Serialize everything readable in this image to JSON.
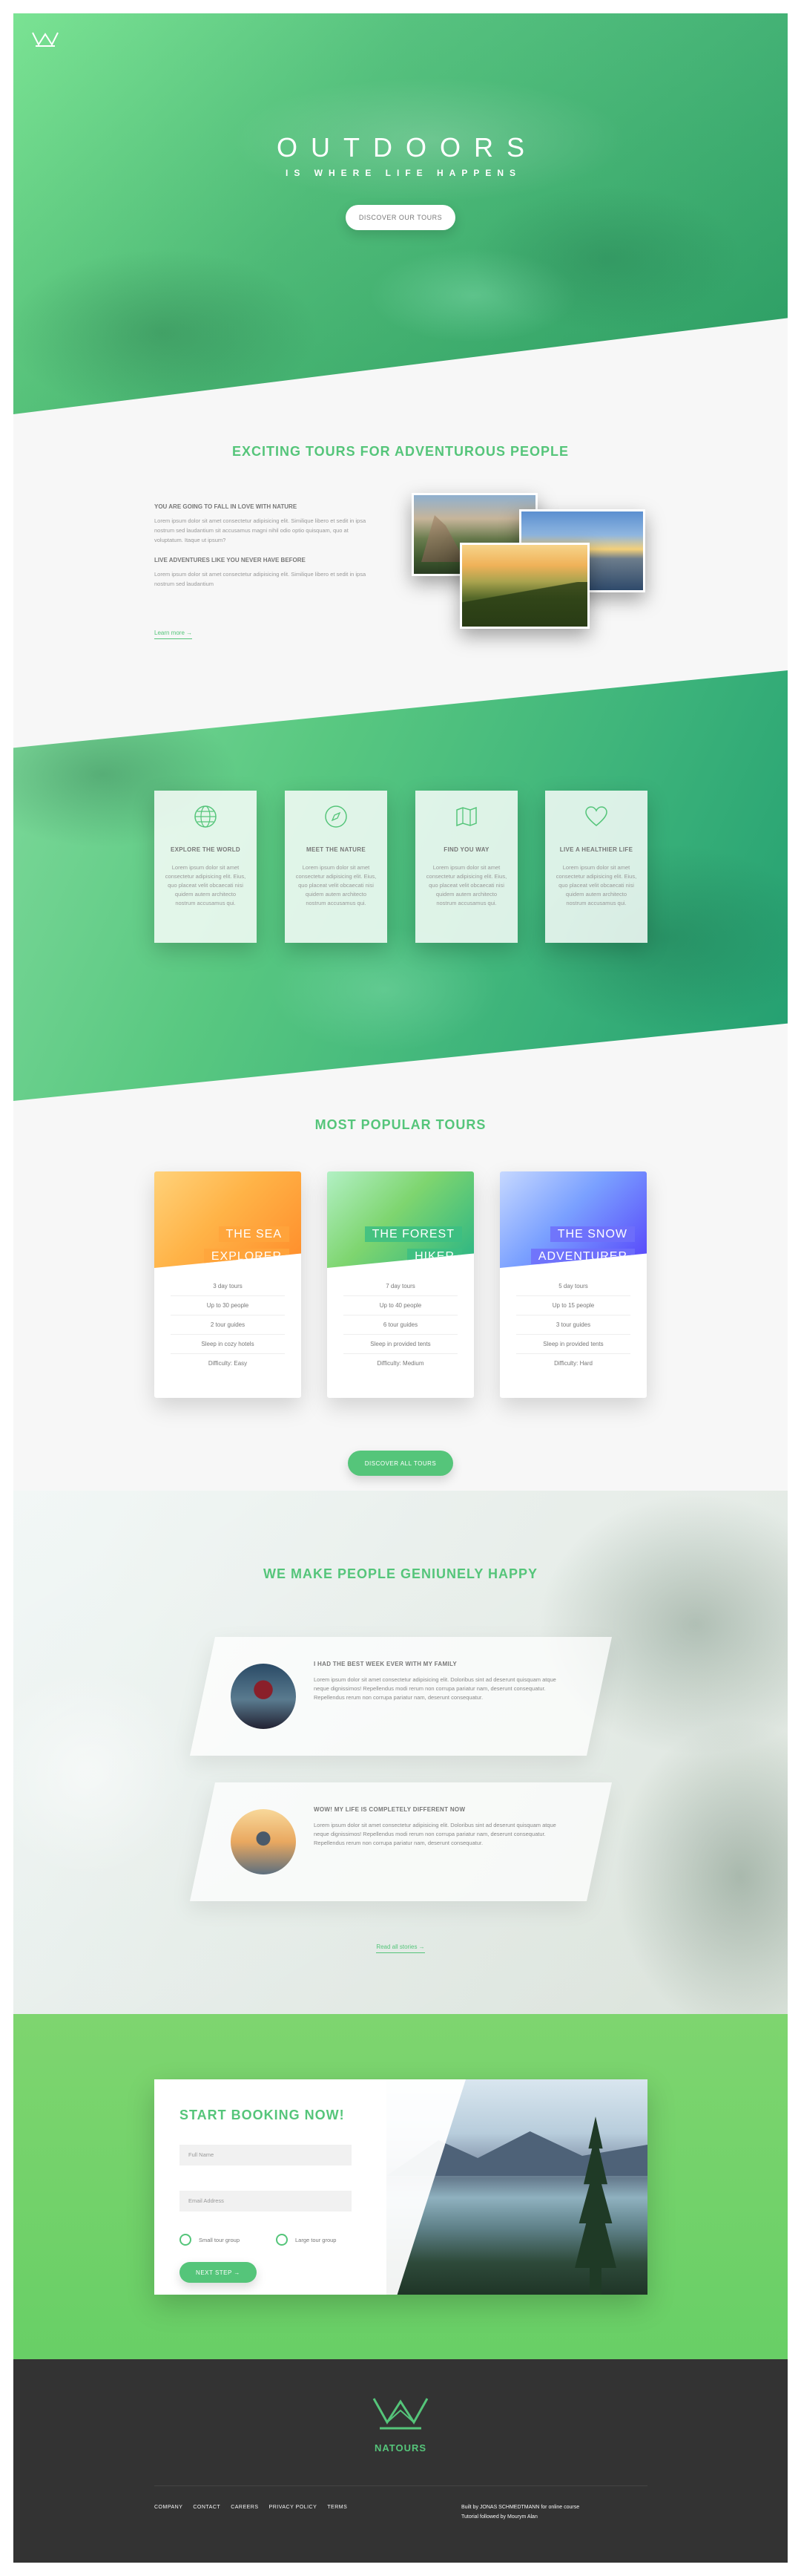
{
  "hero": {
    "title": "OUTDOORS",
    "subtitle": "IS WHERE LIFE HAPPENS",
    "cta": "DISCOVER OUR TOURS"
  },
  "about": {
    "title": "EXCITING TOURS FOR ADVENTUROUS PEOPLE",
    "h1": "YOU ARE GOING TO FALL IN LOVE WITH NATURE",
    "p1": "Lorem ipsum dolor sit amet consectetur adipisicing elit. Similique libero et sedit in ipsa nostrum sed laudantium sit accusamus magni nihil odio optio quisquam, quo at voluptatum. Itaque ut ipsum?",
    "h2": "LIVE ADVENTURES LIKE YOU NEVER HAVE BEFORE",
    "p2": "Lorem ipsum dolor sit amet consectetur adipisicing elit. Similique libero et sedit in ipsa nostrum sed laudantium",
    "link": "Learn more →"
  },
  "features": [
    {
      "icon": "globe-icon",
      "title": "EXPLORE THE WORLD",
      "text": "Lorem ipsum dolor sit amet consectetur adipisicing elit. Eius, quo placeat velit obcaecati nisi quidem autem architecto nostrum accusamus qui."
    },
    {
      "icon": "compass-icon",
      "title": "MEET THE NATURE",
      "text": "Lorem ipsum dolor sit amet consectetur adipisicing elit. Eius, quo placeat velit obcaecati nisi quidem autem architecto nostrum accusamus qui."
    },
    {
      "icon": "map-icon",
      "title": "FIND YOU WAY",
      "text": "Lorem ipsum dolor sit amet consectetur adipisicing elit. Eius, quo placeat velit obcaecati nisi quidem autem architecto nostrum accusamus qui."
    },
    {
      "icon": "heart-icon",
      "title": "LIVE A HEALTHIER LIFE",
      "text": "Lorem ipsum dolor sit amet consectetur adipisicing elit. Eius, quo placeat velit obcaecati nisi quidem autem architecto nostrum accusamus qui."
    }
  ],
  "tours": {
    "title": "MOST POPULAR TOURS",
    "cards": [
      {
        "line1": "THE SEA",
        "line2": "EXPLORER",
        "details": [
          "3 day tours",
          "Up to 30 people",
          "2 tour guides",
          "Sleep in cozy hotels",
          "Difficulty: Easy"
        ]
      },
      {
        "line1": "THE FOREST",
        "line2": "HIKER",
        "details": [
          "7 day tours",
          "Up to 40 people",
          "6 tour guides",
          "Sleep in provided tents",
          "Difficulty: Medium"
        ]
      },
      {
        "line1": "THE SNOW",
        "line2": "ADVENTURER",
        "details": [
          "5 day tours",
          "Up to 15 people",
          "3 tour guides",
          "Sleep in provided tents",
          "Difficulty: Hard"
        ]
      }
    ],
    "cta": "DISCOVER ALL TOURS"
  },
  "stories": {
    "title": "WE MAKE PEOPLE GENIUNELY HAPPY",
    "items": [
      {
        "title": "I HAD THE BEST WEEK EVER WITH MY FAMILY",
        "text": "Lorem ipsum dolor sit amet consectetur adipisicing elit. Doloribus sint ad deserunt quisquam atque neque dignissimos! Repellendus modi rerum non corrupa pariatur nam, deserunt consequatur. Repellendus rerum non corrupa pariatur nam, deserunt consequatur."
      },
      {
        "title": "WOW! MY LIFE IS COMPLETELY DIFFERENT NOW",
        "text": "Lorem ipsum dolor sit amet consectetur adipisicing elit. Doloribus sint ad deserunt quisquam atque neque dignissimos! Repellendus modi rerum non corrupa pariatur nam, deserunt consequatur. Repellendus rerum non corrupa pariatur nam, deserunt consequatur."
      }
    ],
    "link": "Read all stories →"
  },
  "booking": {
    "title": "START BOOKING NOW!",
    "name_placeholder": "Full Name",
    "email_placeholder": "Email Address",
    "radio1": "Small tour group",
    "radio2": "Large tour group",
    "cta": "NEXT STEP →"
  },
  "footer": {
    "brand": "NATOURS",
    "nav": [
      "COMPANY",
      "CONTACT",
      "CAREERS",
      "PRIVACY POLICY",
      "TERMS"
    ],
    "credit1": "Built by JONAS SCHMEDTMANN for online course",
    "credit2": "Tutorial followed by Mourym Alan"
  },
  "colors": {
    "primary": "#55c57a",
    "light": "#7ed56f",
    "dark": "#28b485",
    "footer": "#333333"
  }
}
